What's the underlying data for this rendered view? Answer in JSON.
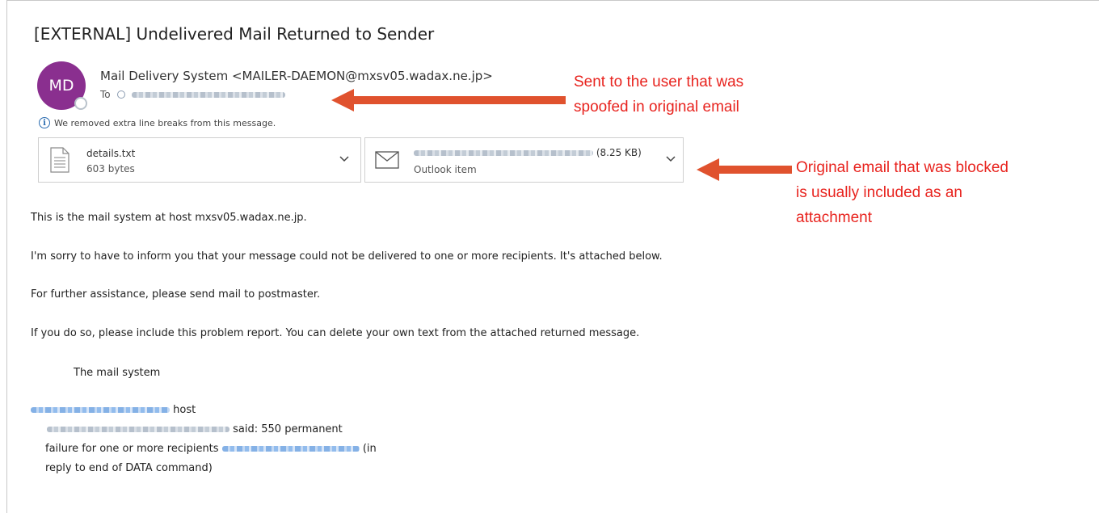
{
  "email": {
    "subject": "[EXTERNAL] Undelivered Mail Returned to Sender",
    "avatar_initials": "MD",
    "sender": "Mail Delivery System <MAILER-DAEMON@mxsv05.wadax.ne.jp>",
    "to_label": "To",
    "info_notice": "We removed extra line breaks from this message.",
    "attachments": [
      {
        "name": "details.txt",
        "size": "603 bytes",
        "icon": "text-file-icon"
      },
      {
        "size_suffix": "(8.25 KB)",
        "type": "Outlook item",
        "icon": "envelope-icon"
      }
    ],
    "body": {
      "line1": "This is the mail system at host mxsv05.wadax.ne.jp.",
      "line2": "I'm sorry to have to inform you that your message could not be delivered to one or more recipients. It's attached below.",
      "line3": "For further assistance, please send mail to postmaster.",
      "line4": "If you do so, please include this problem report. You can delete your own text from the attached returned message.",
      "signature": "The mail system",
      "host_word": "host",
      "said_text": "said: 550 permanent",
      "failure_text": "failure for one or more recipients",
      "in_text": "(in",
      "reply_text": "reply to end of DATA command)"
    }
  },
  "annotations": {
    "top_line1": "Sent to the user that was",
    "top_line2": "spoofed in original email",
    "right_line1": "Original email that was blocked",
    "right_line2": "is usually included as an",
    "right_line3": "attachment",
    "color": "#e8231e",
    "arrow_color": "#e0522e"
  },
  "colors": {
    "avatar": "#8a2f8f",
    "info_icon": "#2b6cb0"
  }
}
